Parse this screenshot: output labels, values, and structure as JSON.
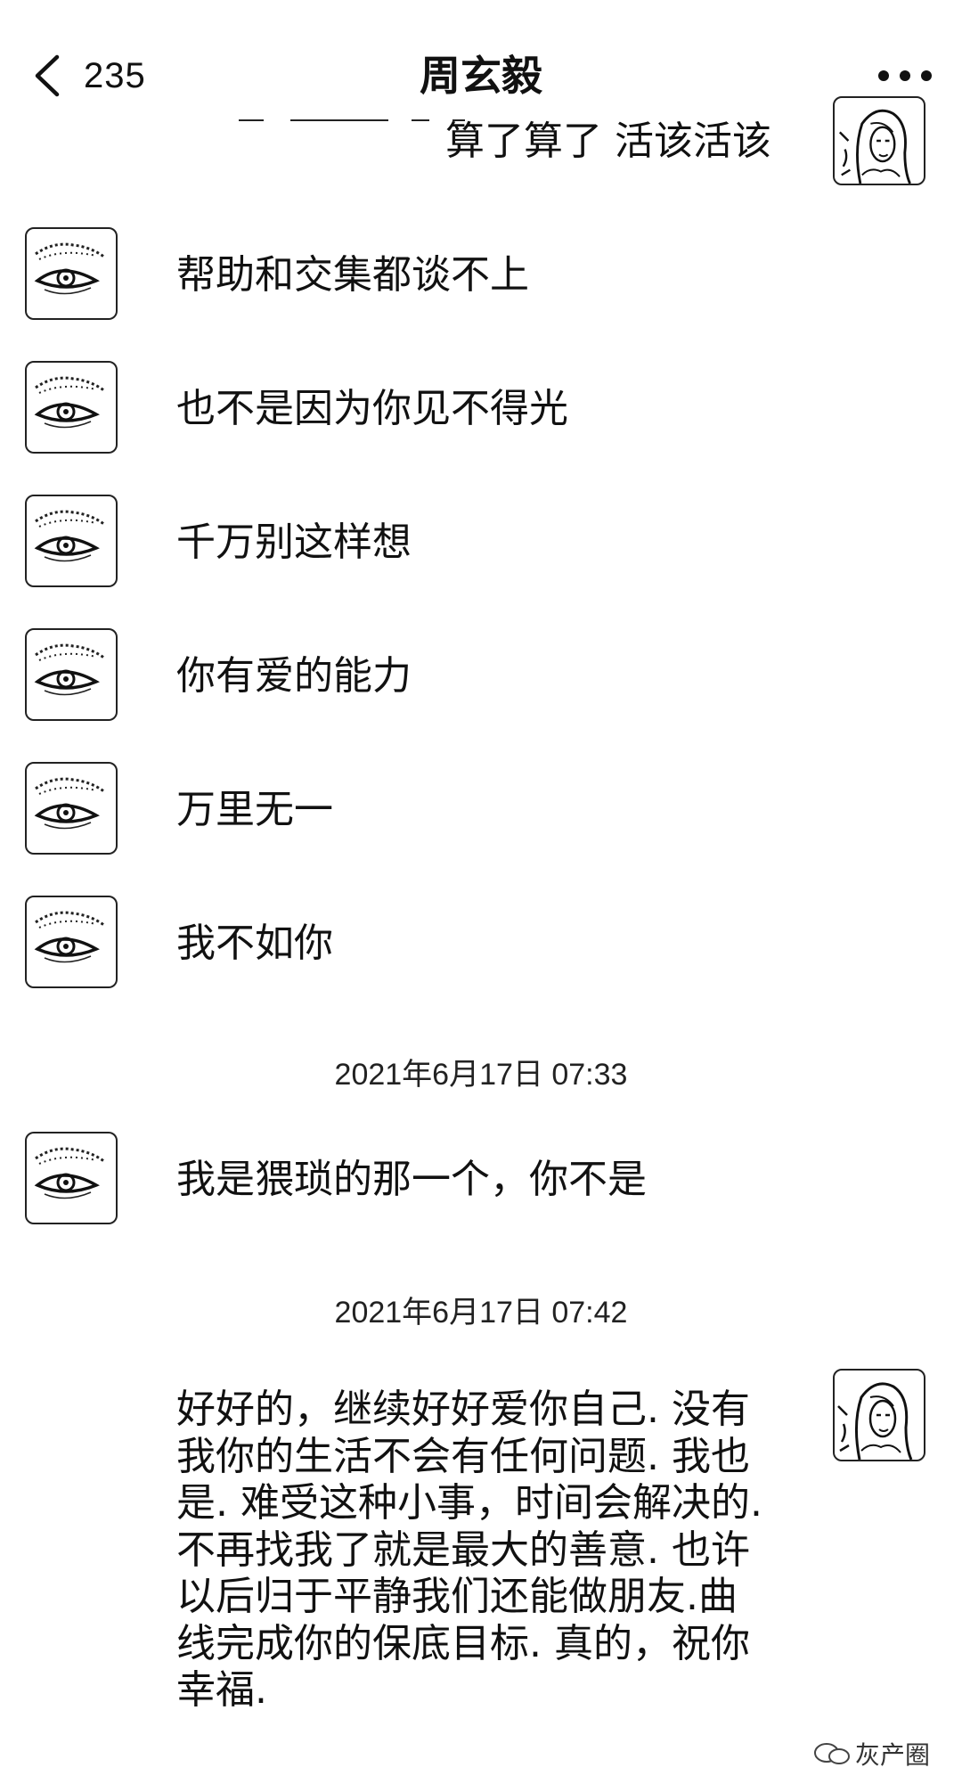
{
  "header": {
    "back_count": "235",
    "title": "周玄毅"
  },
  "messages": [
    {
      "side": "right",
      "text": "算了算了 活该活该"
    },
    {
      "side": "left",
      "text": "帮助和交集都谈不上"
    },
    {
      "side": "left",
      "text": "也不是因为你见不得光"
    },
    {
      "side": "left",
      "text": "千万别这样想"
    },
    {
      "side": "left",
      "text": "你有爱的能力"
    },
    {
      "side": "left",
      "text": "万里无一"
    },
    {
      "side": "left",
      "text": "我不如你"
    },
    {
      "type": "time",
      "text": "2021年6月17日 07:33"
    },
    {
      "side": "left",
      "text": "我是猥琐的那一个，你不是"
    },
    {
      "type": "time",
      "text": "2021年6月17日 07:42"
    },
    {
      "side": "right",
      "text": "好好的，继续好好爱你自己. 没有我你的生活不会有任何问题. 我也是. 难受这种小事，时间会解决的. 不再找我了就是最大的善意. 也许以后归于平静我们还能做朋友.曲线完成你的保底目标. 真的，祝你幸福."
    }
  ],
  "watermark": "灰产圈",
  "icons": {
    "back": "chevron-left-icon",
    "more": "more-dots-icon",
    "left_avatar": "eye-avatar",
    "right_avatar": "woman-portrait-avatar"
  }
}
